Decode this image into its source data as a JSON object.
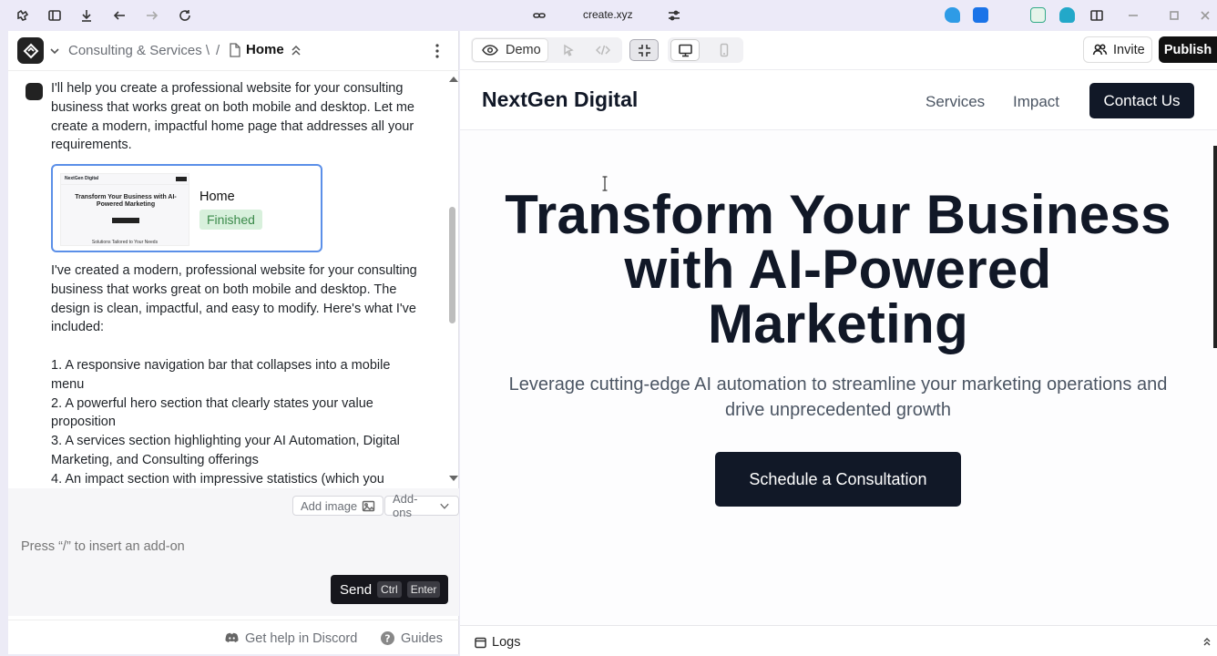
{
  "browser": {
    "url": "create.xyz"
  },
  "left_panel": {
    "breadcrumb": {
      "parent": "Consulting & Services \\",
      "separator": "/",
      "current": "Home"
    },
    "messages": {
      "intro": "I'll help you create a professional website for your consulting business that works great on both mobile and desktop. Let me create a modern, impactful home page that addresses all your requirements.",
      "summary_intro": "I've created a modern, professional website for your consulting business that works great on both mobile and desktop. The design is clean, impactful, and easy to modify. Here's what I've included:",
      "list": [
        "1. A responsive navigation bar that collapses into a mobile menu",
        "2. A powerful hero section that clearly states your value proposition",
        "3. A services section highlighting your AI Automation, Digital Marketing, and Consulting offerings",
        "4. An impact section with impressive statistics (which you"
      ]
    },
    "page_card": {
      "title": "Home",
      "status": "Finished",
      "thumb_nav": "NextGen Digital",
      "thumb_title": "Transform Your Business with AI-Powered Marketing",
      "thumb_footer": "Solutions Tailored to Your Needs"
    },
    "composer": {
      "add_image": "Add image",
      "addons": "Add-ons",
      "placeholder": "Press “/” to insert an add-on",
      "send": "Send",
      "kbd_ctrl": "Ctrl",
      "kbd_enter": "Enter"
    },
    "footer": {
      "discord": "Get help in Discord",
      "guides": "Guides"
    }
  },
  "right_panel": {
    "toolbar": {
      "demo": "Demo",
      "invite": "Invite",
      "publish": "Publish"
    },
    "preview": {
      "brand": "NextGen Digital",
      "nav": [
        "Services",
        "Impact"
      ],
      "contact": "Contact Us",
      "hero_title": "Transform Your Business with AI-Powered Marketing",
      "hero_subtitle": "Leverage cutting-edge AI automation to streamline your marketing operations and drive unprecedented growth",
      "cta": "Schedule a Consultation"
    },
    "footer": {
      "logs": "Logs"
    }
  },
  "colors": {
    "accent_blue": "#5b8fe8",
    "dark": "#111827",
    "success_bg": "#d8f0dc",
    "success_text": "#3b8a4a"
  }
}
